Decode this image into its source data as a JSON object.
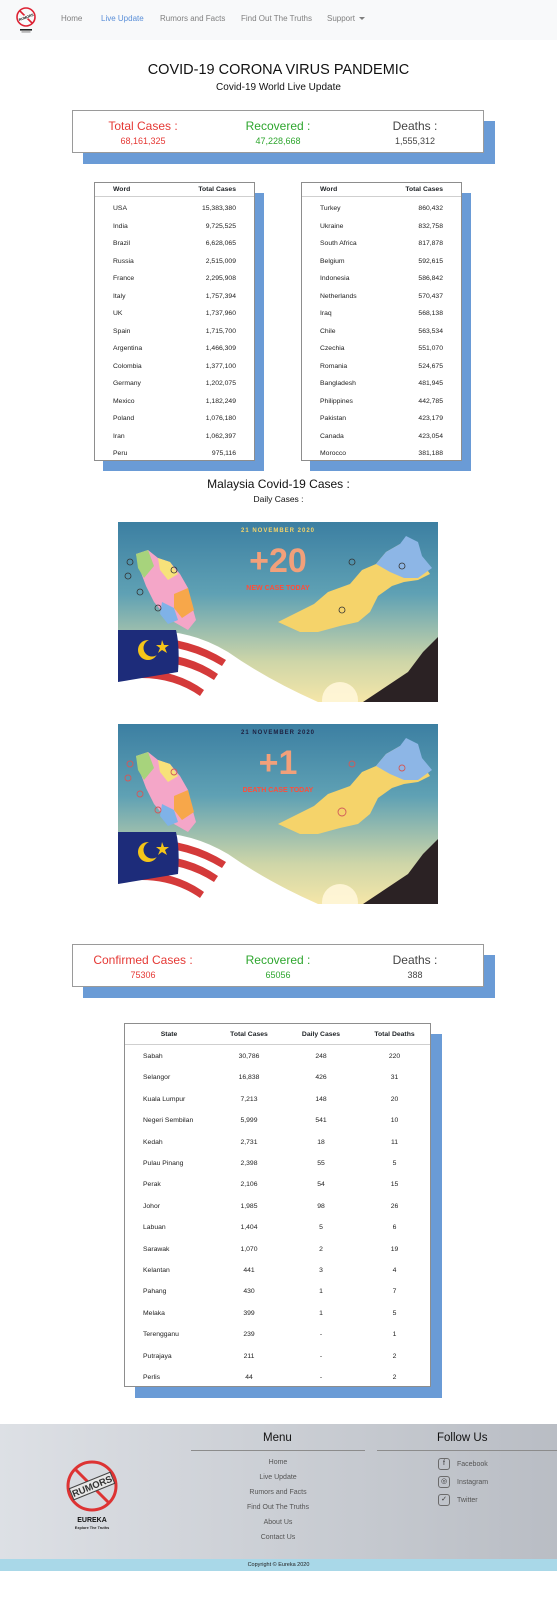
{
  "nav": {
    "logo_text": "RUMORS",
    "items": [
      {
        "label": "Home"
      },
      {
        "label": "Live Update"
      },
      {
        "label": "Rumors and Facts"
      },
      {
        "label": "Find Out The Truths"
      },
      {
        "label": "Support"
      }
    ],
    "active": "Live Update"
  },
  "header": {
    "title": "COVID-19 CORONA VIRUS PANDEMIC",
    "subtitle": "Covid-19 World Live Update"
  },
  "world_stats": {
    "total_label": "Total Cases :",
    "total_value": "68,161,325",
    "recovered_label": "Recovered :",
    "recovered_value": "47,228,668",
    "deaths_label": "Deaths :",
    "deaths_value": "1,555,312"
  },
  "world_table_left": {
    "headers": [
      "Word",
      "Total Cases"
    ],
    "rows": [
      [
        "USA",
        "15,383,380"
      ],
      [
        "India",
        "9,725,525"
      ],
      [
        "Brazil",
        "6,628,065"
      ],
      [
        "Russia",
        "2,515,009"
      ],
      [
        "France",
        "2,295,908"
      ],
      [
        "Italy",
        "1,757,394"
      ],
      [
        "UK",
        "1,737,960"
      ],
      [
        "Spain",
        "1,715,700"
      ],
      [
        "Argentina",
        "1,466,309"
      ],
      [
        "Colombia",
        "1,377,100"
      ],
      [
        "Germany",
        "1,202,075"
      ],
      [
        "Mexico",
        "1,182,249"
      ],
      [
        "Poland",
        "1,076,180"
      ],
      [
        "Iran",
        "1,062,397"
      ],
      [
        "Peru",
        "975,116"
      ]
    ]
  },
  "world_table_right": {
    "headers": [
      "Word",
      "Total Cases"
    ],
    "rows": [
      [
        "Turkey",
        "860,432"
      ],
      [
        "Ukraine",
        "832,758"
      ],
      [
        "South Africa",
        "817,878"
      ],
      [
        "Belgium",
        "592,615"
      ],
      [
        "Indonesia",
        "586,842"
      ],
      [
        "Netherlands",
        "570,437"
      ],
      [
        "Iraq",
        "568,138"
      ],
      [
        "Chile",
        "563,534"
      ],
      [
        "Czechia",
        "551,070"
      ],
      [
        "Romania",
        "524,675"
      ],
      [
        "Bangladesh",
        "481,945"
      ],
      [
        "Philippines",
        "442,785"
      ],
      [
        "Pakistan",
        "423,179"
      ],
      [
        "Canada",
        "423,054"
      ],
      [
        "Morocco",
        "381,188"
      ]
    ]
  },
  "malaysia": {
    "title": "Malaysia Covid-19 Cases :",
    "subtitle": "Daily Cases :"
  },
  "infographics": [
    {
      "date": "21 NOVEMBER 2020",
      "number": "+20",
      "caption": "NEW CASE TODAY"
    },
    {
      "date": "21 NOVEMBER 2020",
      "number": "+1",
      "caption": "DEATH CASE TODAY"
    }
  ],
  "my_stats": {
    "confirmed_label": "Confirmed Cases :",
    "confirmed_value": "75306",
    "recovered_label": "Recovered :",
    "recovered_value": "65056",
    "deaths_label": "Deaths :",
    "deaths_value": "388"
  },
  "state_table": {
    "headers": [
      "State",
      "Total Cases",
      "Daily Cases",
      "Total Deaths"
    ],
    "rows": [
      [
        "Sabah",
        "30,786",
        "248",
        "220"
      ],
      [
        "Selangor",
        "16,838",
        "426",
        "31"
      ],
      [
        "Kuala Lumpur",
        "7,213",
        "148",
        "20"
      ],
      [
        "Negeri Sembilan",
        "5,999",
        "541",
        "10"
      ],
      [
        "Kedah",
        "2,731",
        "18",
        "11"
      ],
      [
        "Pulau Pinang",
        "2,398",
        "55",
        "5"
      ],
      [
        "Perak",
        "2,106",
        "54",
        "15"
      ],
      [
        "Johor",
        "1,985",
        "98",
        "26"
      ],
      [
        "Labuan",
        "1,404",
        "5",
        "6"
      ],
      [
        "Sarawak",
        "1,070",
        "2",
        "19"
      ],
      [
        "Kelantan",
        "441",
        "3",
        "4"
      ],
      [
        "Pahang",
        "430",
        "1",
        "7"
      ],
      [
        "Melaka",
        "399",
        "1",
        "5"
      ],
      [
        "Terengganu",
        "239",
        "-",
        "1"
      ],
      [
        "Putrajaya",
        "211",
        "-",
        "2"
      ],
      [
        "Perlis",
        "44",
        "-",
        "2"
      ]
    ]
  },
  "footer": {
    "brand": "EUREKA",
    "tagline": "Explore The Truths",
    "logo_text": "RUMORS",
    "menu_title": "Menu",
    "menu": [
      "Home",
      "Live Update",
      "Rumors and Facts",
      "Find Out The Truths",
      "About Us",
      "Contact Us"
    ],
    "follow_title": "Follow Us",
    "social": [
      {
        "icon": "facebook-icon",
        "glyph": "f",
        "label": "Facebook"
      },
      {
        "icon": "instagram-icon",
        "glyph": "◎",
        "label": "Instagram"
      },
      {
        "icon": "twitter-icon",
        "glyph": "✓",
        "label": "Twitter"
      }
    ],
    "copyright": "Copyright © Eureka 2020"
  },
  "colors": {
    "accent_blue": "#6a9bd6",
    "red": "#e53935",
    "green": "#2ea62e",
    "nav_active": "#5a8fd8"
  }
}
